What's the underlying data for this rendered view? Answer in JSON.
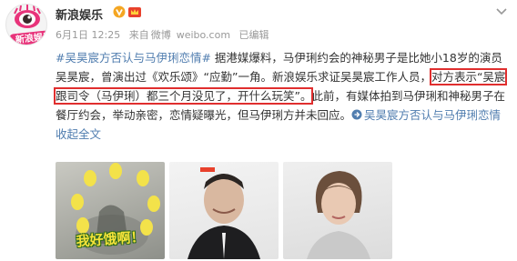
{
  "user": {
    "name": "新浪娱乐",
    "avatar_text": "新浪娱乐"
  },
  "meta": {
    "date": "6月1日 12:25",
    "source_prefix": "来自",
    "source": "微博",
    "site": "weibo.com",
    "edited": "已编辑"
  },
  "post": {
    "topic": "#吴昊宸方否认与马伊琍恋情#",
    "text_before": " 据港媒爆料，马伊琍约会的神秘男子是比她小18岁的演员吴昊宸，曾演出过《欢乐颂》“应勤”一角。新浪娱乐求证吴昊宸工作人员，",
    "highlight": "对方表示“吴宸跟司令（马伊琍）都三个月没见了，开什么玩笑”。",
    "text_after": "此前，有媒体拍到马伊琍和神秘男子在餐厅约会，举动亲密，恋情疑曝光，但马伊琍方并未回应。",
    "link_text": "吴昊宸方否认与马伊琍恋情",
    "collapse": "收起全文"
  },
  "photos": {
    "caption": "我好饿啊！"
  },
  "colors": {
    "link": "#507daf",
    "highlight_border": "#e02e2e",
    "vip_badge": "#f4a622"
  }
}
